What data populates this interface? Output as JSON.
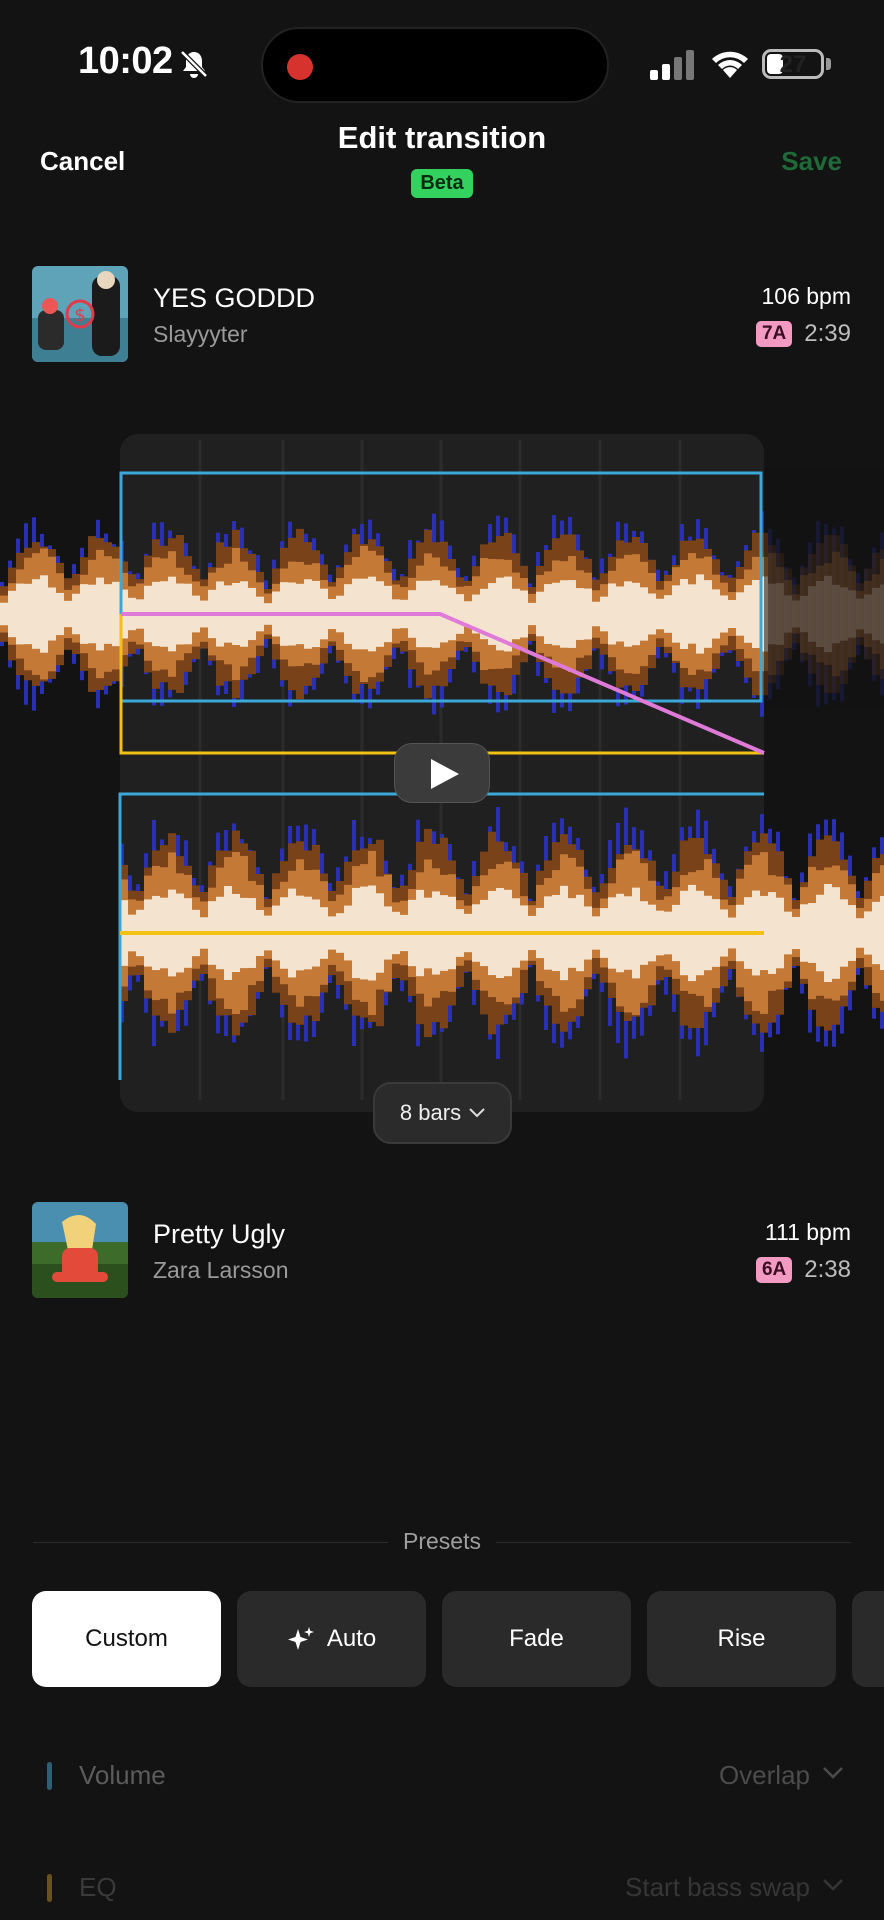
{
  "status_bar": {
    "time": "10:02",
    "battery": "27"
  },
  "nav": {
    "cancel": "Cancel",
    "title": "Edit transition",
    "badge": "Beta",
    "save": "Save"
  },
  "track_a": {
    "title": "YES GODDD",
    "artist": "Slayyyter",
    "bpm": "106 bpm",
    "key": "7A",
    "duration": "2:39"
  },
  "track_b": {
    "title": "Pretty Ugly",
    "artist": "Zara Larsson",
    "bpm": "111 bpm",
    "key": "6A",
    "duration": "2:38"
  },
  "editor": {
    "bars_label": "8 bars"
  },
  "presets": {
    "label": "Presets",
    "items": [
      {
        "label": "Custom",
        "active": true
      },
      {
        "label": "Auto",
        "icon": "sparkle-icon"
      },
      {
        "label": "Fade"
      },
      {
        "label": "Rise"
      }
    ]
  },
  "settings": [
    {
      "label": "Volume",
      "value": "Overlap",
      "color": "#2f93b5"
    },
    {
      "label": "EQ",
      "value": "Start bass swap",
      "color": "#b58a1c"
    }
  ],
  "colors": {
    "accent_save": "#1f6a38",
    "beta_badge": "#33d25f",
    "key_badge": "#f39ac3",
    "volume_line": "#e07ad8",
    "eq_line": "#f2c114",
    "frame_line": "#3aa8d8",
    "wave_light": "#f4e4cf",
    "wave_mid": "#c47a36",
    "wave_dark": "#7a4218",
    "wave_blue": "#2a2fb8"
  }
}
